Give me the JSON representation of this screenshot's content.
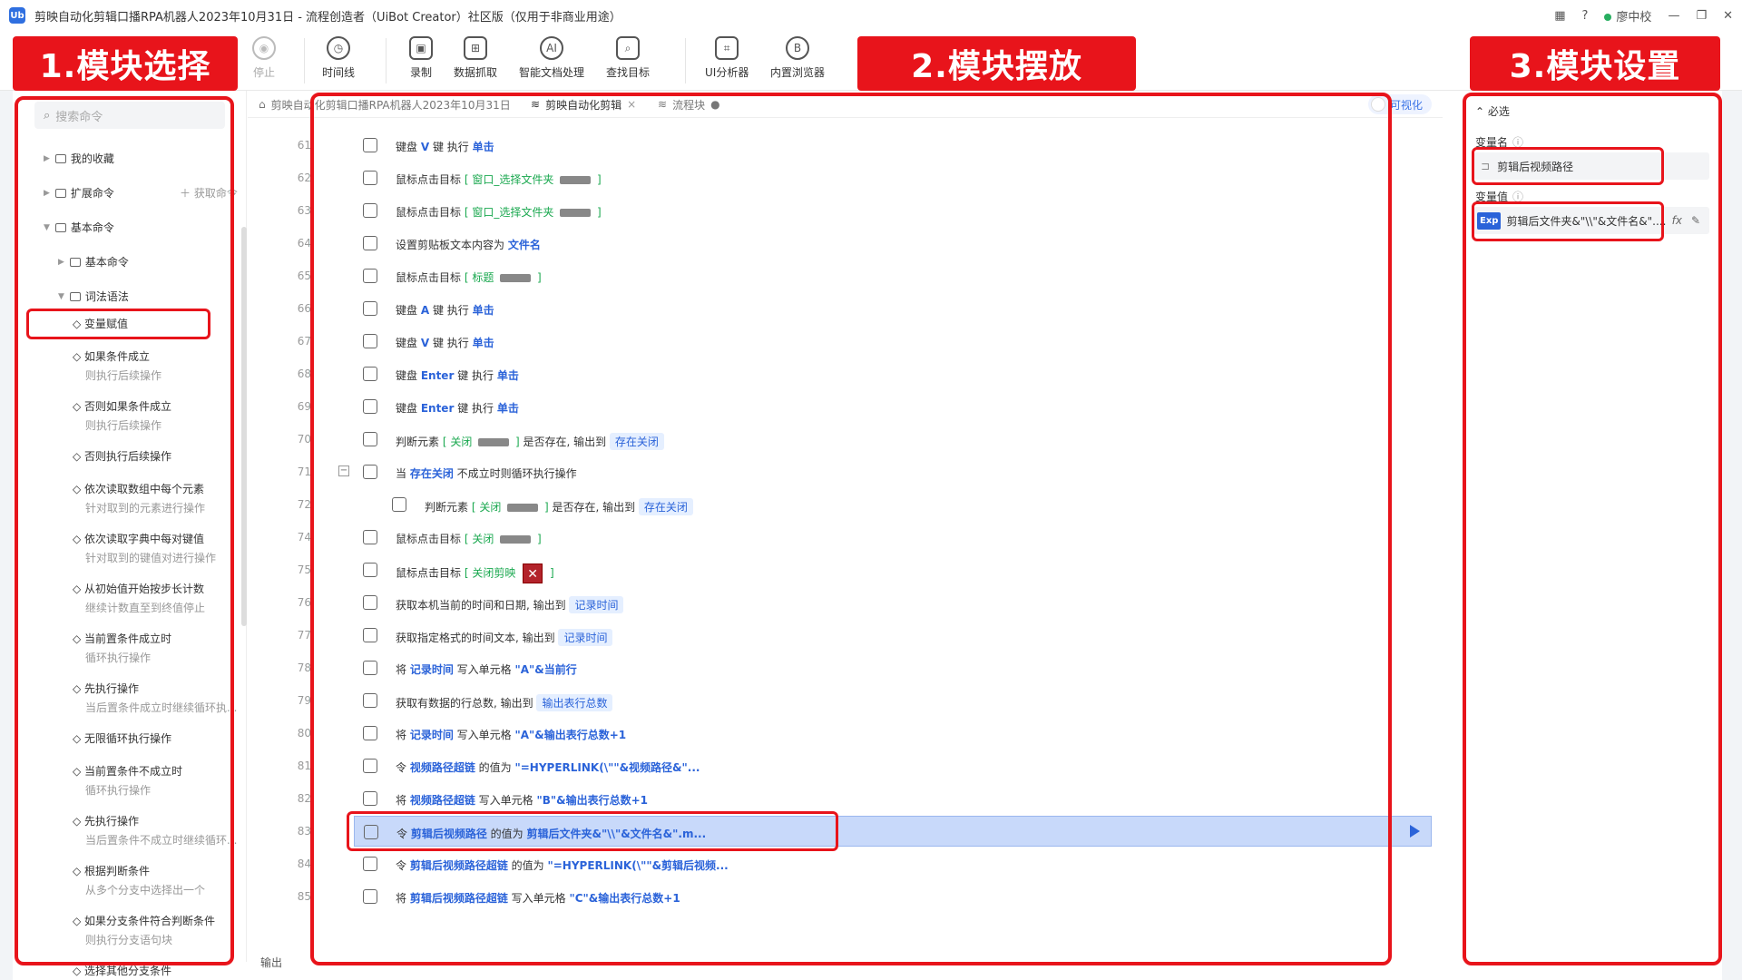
{
  "window": {
    "title": "剪映自动化剪辑口播RPA机器人2023年10月31日 - 流程创造者（UiBot Creator）社区版（仅用于非商业用途）",
    "user": "廖中校",
    "help": "?"
  },
  "toolbar": {
    "items": [
      "停止",
      "时间线",
      "录制",
      "数据抓取",
      "智能文档处理",
      "查找目标",
      "UI分析器",
      "内置浏览器"
    ]
  },
  "annotations": {
    "label1": "1.模块选择",
    "label2": "2.模块摆放",
    "label3": "3.模块设置"
  },
  "left": {
    "search_placeholder": "搜索命令",
    "tree": [
      {
        "label": "我的收藏"
      },
      {
        "label": "扩展命令",
        "extra": "获取命令"
      },
      {
        "label": "基本命令"
      },
      {
        "label": "基本命令"
      },
      {
        "label": "词法语法"
      }
    ],
    "commands": [
      {
        "title": "变量赋值",
        "sub": ""
      },
      {
        "title": "如果条件成立",
        "sub": "则执行后续操作"
      },
      {
        "title": "否则如果条件成立",
        "sub": "则执行后续操作"
      },
      {
        "title": "否则执行后续操作",
        "sub": ""
      },
      {
        "title": "依次读取数组中每个元素",
        "sub": "针对取到的元素进行操作"
      },
      {
        "title": "依次读取字典中每对键值",
        "sub": "针对取到的键值对进行操作"
      },
      {
        "title": "从初始值开始按步长计数",
        "sub": "继续计数直至到终值停止"
      },
      {
        "title": "当前置条件成立时",
        "sub": "循环执行操作"
      },
      {
        "title": "先执行操作",
        "sub": "当后置条件成立时继续循环执..."
      },
      {
        "title": "无限循环执行操作",
        "sub": ""
      },
      {
        "title": "当前置条件不成立时",
        "sub": "循环执行操作"
      },
      {
        "title": "先执行操作",
        "sub": "当后置条件不成立时继续循环..."
      },
      {
        "title": "根据判断条件",
        "sub": "从多个分支中选择出一个"
      },
      {
        "title": "如果分支条件符合判断条件",
        "sub": "则执行分支语句块"
      },
      {
        "title": "选择其他分支条件",
        "sub": ""
      }
    ]
  },
  "tabs": {
    "t1": "剪映自动化剪辑口播RPA机器人2023年10月31日",
    "t2": "剪映自动化剪辑",
    "t3": "流程块",
    "toggle": "可视化"
  },
  "lines": [
    {
      "n": "61",
      "parts": [
        [
          "t",
          "键盘 "
        ],
        [
          "k",
          "V"
        ],
        [
          "t",
          " 键 执行 "
        ],
        [
          "k",
          "单击"
        ]
      ]
    },
    {
      "n": "62",
      "parts": [
        [
          "t",
          "鼠标点击目标 "
        ],
        [
          "g",
          "[ 窗口_选择文件夹 "
        ],
        [
          "c",
          ""
        ],
        [
          "g",
          " ]"
        ]
      ]
    },
    {
      "n": "63",
      "parts": [
        [
          "t",
          "鼠标点击目标 "
        ],
        [
          "g",
          "[ 窗口_选择文件夹 "
        ],
        [
          "c",
          ""
        ],
        [
          "g",
          " ]"
        ]
      ]
    },
    {
      "n": "64",
      "parts": [
        [
          "t",
          "设置剪贴板文本内容为 "
        ],
        [
          "k",
          "文件名"
        ]
      ]
    },
    {
      "n": "65",
      "parts": [
        [
          "t",
          "鼠标点击目标 "
        ],
        [
          "g",
          "[ 标题 "
        ],
        [
          "c",
          ""
        ],
        [
          "g",
          " ]"
        ]
      ]
    },
    {
      "n": "66",
      "parts": [
        [
          "t",
          "键盘 "
        ],
        [
          "k",
          "A"
        ],
        [
          "t",
          " 键 执行 "
        ],
        [
          "k",
          "单击"
        ]
      ]
    },
    {
      "n": "67",
      "parts": [
        [
          "t",
          "键盘 "
        ],
        [
          "k",
          "V"
        ],
        [
          "t",
          " 键 执行 "
        ],
        [
          "k",
          "单击"
        ]
      ]
    },
    {
      "n": "68",
      "parts": [
        [
          "t",
          "键盘 "
        ],
        [
          "k",
          "Enter"
        ],
        [
          "t",
          " 键 执行 "
        ],
        [
          "k",
          "单击"
        ]
      ]
    },
    {
      "n": "69",
      "parts": [
        [
          "t",
          "键盘 "
        ],
        [
          "k",
          "Enter"
        ],
        [
          "t",
          " 键 执行 "
        ],
        [
          "k",
          "单击"
        ]
      ]
    },
    {
      "n": "70",
      "parts": [
        [
          "t",
          "判断元素 "
        ],
        [
          "g",
          "[ 关闭 "
        ],
        [
          "c",
          ""
        ],
        [
          "g",
          " ]"
        ],
        [
          "t",
          " 是否存在, 输出到 "
        ],
        [
          "v",
          "存在关闭"
        ]
      ]
    },
    {
      "n": "71",
      "parts": [
        [
          "t",
          "当 "
        ],
        [
          "k",
          "存在关闭"
        ],
        [
          "t",
          " 不成立时则循环执行操作"
        ]
      ]
    },
    {
      "n": "72",
      "parts": [
        [
          "t",
          "判断元素 "
        ],
        [
          "g",
          "[ 关闭 "
        ],
        [
          "c",
          ""
        ],
        [
          "g",
          " ]"
        ],
        [
          "t",
          " 是否存在, 输出到 "
        ],
        [
          "v",
          "存在关闭"
        ]
      ]
    },
    {
      "n": "74",
      "parts": [
        [
          "t",
          "鼠标点击目标 "
        ],
        [
          "g",
          "[ 关闭 "
        ],
        [
          "c",
          ""
        ],
        [
          "g",
          " ]"
        ]
      ]
    },
    {
      "n": "75",
      "parts": [
        [
          "t",
          "鼠标点击目标 "
        ],
        [
          "g",
          "[ 关闭剪映 "
        ],
        [
          "x",
          "✕"
        ],
        [
          "g",
          " ]"
        ]
      ]
    },
    {
      "n": "76",
      "parts": [
        [
          "t",
          "获取本机当前的时间和日期, 输出到 "
        ],
        [
          "v",
          "记录时间"
        ]
      ]
    },
    {
      "n": "77",
      "parts": [
        [
          "t",
          "获取指定格式的时间文本, 输出到 "
        ],
        [
          "v",
          "记录时间"
        ]
      ]
    },
    {
      "n": "78",
      "parts": [
        [
          "t",
          "将 "
        ],
        [
          "k",
          "记录时间"
        ],
        [
          "t",
          " 写入单元格 "
        ],
        [
          "k",
          "\"A\"&当前行"
        ]
      ]
    },
    {
      "n": "79",
      "parts": [
        [
          "t",
          "获取有数据的行总数, 输出到 "
        ],
        [
          "v",
          "输出表行总数"
        ]
      ]
    },
    {
      "n": "80",
      "parts": [
        [
          "t",
          "将 "
        ],
        [
          "k",
          "记录时间"
        ],
        [
          "t",
          " 写入单元格 "
        ],
        [
          "k",
          "\"A\"&输出表行总数+1"
        ]
      ]
    },
    {
      "n": "81",
      "parts": [
        [
          "t",
          "令 "
        ],
        [
          "k",
          "视频路径超链"
        ],
        [
          "t",
          " 的值为 "
        ],
        [
          "k",
          "\"=HYPERLINK(\\\"\"&视频路径&\"..."
        ]
      ]
    },
    {
      "n": "82",
      "parts": [
        [
          "t",
          "将 "
        ],
        [
          "k",
          "视频路径超链"
        ],
        [
          "t",
          " 写入单元格 "
        ],
        [
          "k",
          "\"B\"&输出表行总数+1"
        ]
      ]
    },
    {
      "n": "83",
      "parts": [
        [
          "t",
          "令 "
        ],
        [
          "k",
          "剪辑后视频路径"
        ],
        [
          "t",
          " 的值为 "
        ],
        [
          "k",
          "剪辑后文件夹&\"\\\\\"&文件名&\".m..."
        ]
      ]
    },
    {
      "n": "84",
      "parts": [
        [
          "t",
          "令 "
        ],
        [
          "k",
          "剪辑后视频路径超链"
        ],
        [
          "t",
          " 的值为 "
        ],
        [
          "k",
          "\"=HYPERLINK(\\\"\"&剪辑后视频..."
        ]
      ]
    },
    {
      "n": "85",
      "parts": [
        [
          "t",
          "将 "
        ],
        [
          "k",
          "剪辑后视频路径超链"
        ],
        [
          "t",
          " 写入单元格 "
        ],
        [
          "k",
          "\"C\"&输出表行总数+1"
        ]
      ]
    }
  ],
  "output_label": "输出",
  "right": {
    "section": "必选",
    "var_name_label": "变量名",
    "var_name": "剪辑后视频路径",
    "var_value_label": "变量值",
    "var_value": "剪辑后文件夹&\"\\\\\"&文件名&\"....",
    "exp_badge": "Exp",
    "fx": "fx"
  }
}
